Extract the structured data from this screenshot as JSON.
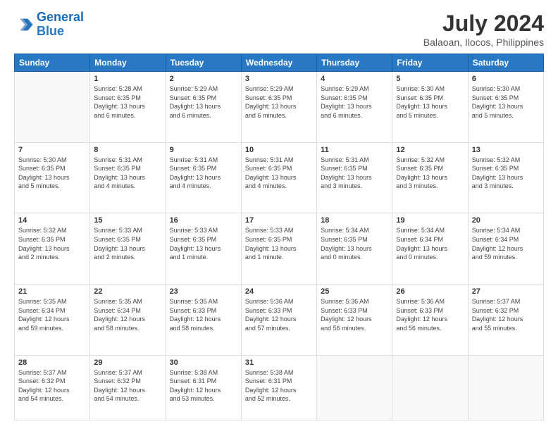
{
  "header": {
    "logo_line1": "General",
    "logo_line2": "Blue",
    "title": "July 2024",
    "subtitle": "Balaoan, Ilocos, Philippines"
  },
  "days_of_week": [
    "Sunday",
    "Monday",
    "Tuesday",
    "Wednesday",
    "Thursday",
    "Friday",
    "Saturday"
  ],
  "weeks": [
    [
      {
        "day": "",
        "info": ""
      },
      {
        "day": "1",
        "info": "Sunrise: 5:28 AM\nSunset: 6:35 PM\nDaylight: 13 hours\nand 6 minutes."
      },
      {
        "day": "2",
        "info": "Sunrise: 5:29 AM\nSunset: 6:35 PM\nDaylight: 13 hours\nand 6 minutes."
      },
      {
        "day": "3",
        "info": "Sunrise: 5:29 AM\nSunset: 6:35 PM\nDaylight: 13 hours\nand 6 minutes."
      },
      {
        "day": "4",
        "info": "Sunrise: 5:29 AM\nSunset: 6:35 PM\nDaylight: 13 hours\nand 6 minutes."
      },
      {
        "day": "5",
        "info": "Sunrise: 5:30 AM\nSunset: 6:35 PM\nDaylight: 13 hours\nand 5 minutes."
      },
      {
        "day": "6",
        "info": "Sunrise: 5:30 AM\nSunset: 6:35 PM\nDaylight: 13 hours\nand 5 minutes."
      }
    ],
    [
      {
        "day": "7",
        "info": "Sunrise: 5:30 AM\nSunset: 6:35 PM\nDaylight: 13 hours\nand 5 minutes."
      },
      {
        "day": "8",
        "info": "Sunrise: 5:31 AM\nSunset: 6:35 PM\nDaylight: 13 hours\nand 4 minutes."
      },
      {
        "day": "9",
        "info": "Sunrise: 5:31 AM\nSunset: 6:35 PM\nDaylight: 13 hours\nand 4 minutes."
      },
      {
        "day": "10",
        "info": "Sunrise: 5:31 AM\nSunset: 6:35 PM\nDaylight: 13 hours\nand 4 minutes."
      },
      {
        "day": "11",
        "info": "Sunrise: 5:31 AM\nSunset: 6:35 PM\nDaylight: 13 hours\nand 3 minutes."
      },
      {
        "day": "12",
        "info": "Sunrise: 5:32 AM\nSunset: 6:35 PM\nDaylight: 13 hours\nand 3 minutes."
      },
      {
        "day": "13",
        "info": "Sunrise: 5:32 AM\nSunset: 6:35 PM\nDaylight: 13 hours\nand 3 minutes."
      }
    ],
    [
      {
        "day": "14",
        "info": "Sunrise: 5:32 AM\nSunset: 6:35 PM\nDaylight: 13 hours\nand 2 minutes."
      },
      {
        "day": "15",
        "info": "Sunrise: 5:33 AM\nSunset: 6:35 PM\nDaylight: 13 hours\nand 2 minutes."
      },
      {
        "day": "16",
        "info": "Sunrise: 5:33 AM\nSunset: 6:35 PM\nDaylight: 13 hours\nand 1 minute."
      },
      {
        "day": "17",
        "info": "Sunrise: 5:33 AM\nSunset: 6:35 PM\nDaylight: 13 hours\nand 1 minute."
      },
      {
        "day": "18",
        "info": "Sunrise: 5:34 AM\nSunset: 6:35 PM\nDaylight: 13 hours\nand 0 minutes."
      },
      {
        "day": "19",
        "info": "Sunrise: 5:34 AM\nSunset: 6:34 PM\nDaylight: 13 hours\nand 0 minutes."
      },
      {
        "day": "20",
        "info": "Sunrise: 5:34 AM\nSunset: 6:34 PM\nDaylight: 12 hours\nand 59 minutes."
      }
    ],
    [
      {
        "day": "21",
        "info": "Sunrise: 5:35 AM\nSunset: 6:34 PM\nDaylight: 12 hours\nand 59 minutes."
      },
      {
        "day": "22",
        "info": "Sunrise: 5:35 AM\nSunset: 6:34 PM\nDaylight: 12 hours\nand 58 minutes."
      },
      {
        "day": "23",
        "info": "Sunrise: 5:35 AM\nSunset: 6:33 PM\nDaylight: 12 hours\nand 58 minutes."
      },
      {
        "day": "24",
        "info": "Sunrise: 5:36 AM\nSunset: 6:33 PM\nDaylight: 12 hours\nand 57 minutes."
      },
      {
        "day": "25",
        "info": "Sunrise: 5:36 AM\nSunset: 6:33 PM\nDaylight: 12 hours\nand 56 minutes."
      },
      {
        "day": "26",
        "info": "Sunrise: 5:36 AM\nSunset: 6:33 PM\nDaylight: 12 hours\nand 56 minutes."
      },
      {
        "day": "27",
        "info": "Sunrise: 5:37 AM\nSunset: 6:32 PM\nDaylight: 12 hours\nand 55 minutes."
      }
    ],
    [
      {
        "day": "28",
        "info": "Sunrise: 5:37 AM\nSunset: 6:32 PM\nDaylight: 12 hours\nand 54 minutes."
      },
      {
        "day": "29",
        "info": "Sunrise: 5:37 AM\nSunset: 6:32 PM\nDaylight: 12 hours\nand 54 minutes."
      },
      {
        "day": "30",
        "info": "Sunrise: 5:38 AM\nSunset: 6:31 PM\nDaylight: 12 hours\nand 53 minutes."
      },
      {
        "day": "31",
        "info": "Sunrise: 5:38 AM\nSunset: 6:31 PM\nDaylight: 12 hours\nand 52 minutes."
      },
      {
        "day": "",
        "info": ""
      },
      {
        "day": "",
        "info": ""
      },
      {
        "day": "",
        "info": ""
      }
    ]
  ]
}
